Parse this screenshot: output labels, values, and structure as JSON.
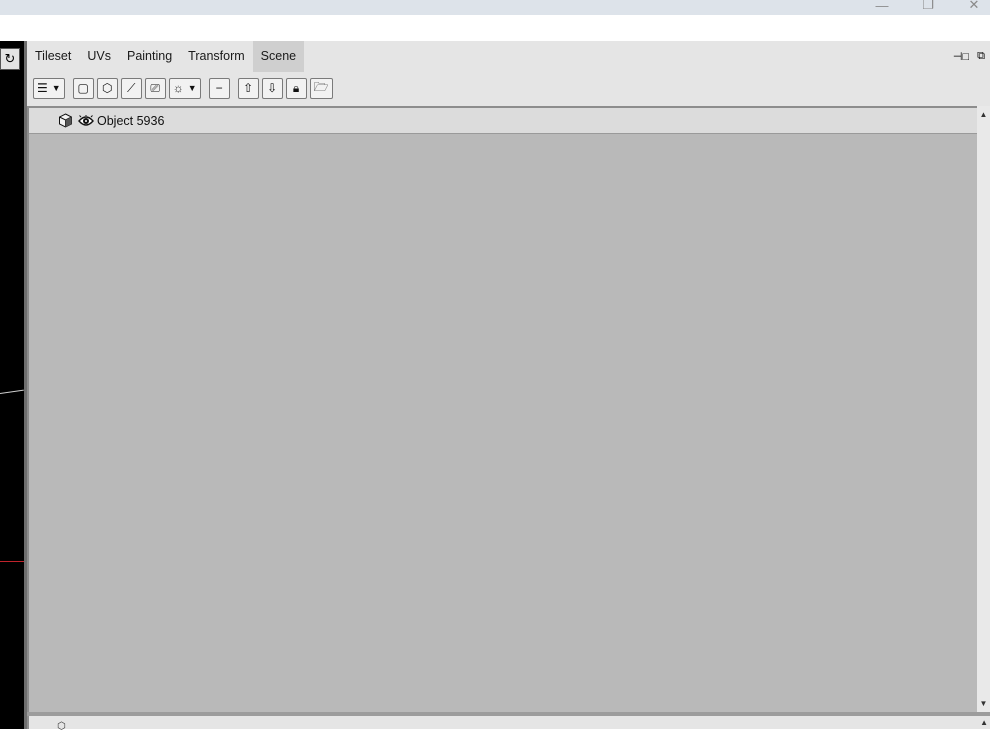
{
  "window": {
    "controls": [
      {
        "name": "minimize-button",
        "glyph": "—"
      },
      {
        "name": "maximize-button",
        "glyph": "❐"
      },
      {
        "name": "close-button",
        "glyph": "✕"
      }
    ]
  },
  "viewport": {
    "refresh_icon": "refresh-icon",
    "refresh_glyph": "↻"
  },
  "tabs": [
    {
      "label": "Tileset",
      "active": false
    },
    {
      "label": "UVs",
      "active": false
    },
    {
      "label": "Painting",
      "active": false
    },
    {
      "label": "Transform",
      "active": false
    },
    {
      "label": "Scene",
      "active": true
    }
  ],
  "dock": {
    "undock_glyph": "⊣□",
    "float_glyph": "⧉"
  },
  "toolbar": [
    {
      "name": "menu-dropdown-button",
      "icon": "hamburger-icon",
      "glyph": "☰",
      "dropdown": true
    },
    {
      "name": "new-shape-button",
      "icon": "shape-icon",
      "glyph": "▢",
      "dropdown": false
    },
    {
      "name": "new-object-button",
      "icon": "cube-icon",
      "glyph": "⬡",
      "dropdown": false
    },
    {
      "name": "new-bone-button",
      "icon": "bone-icon",
      "glyph": "⟋",
      "dropdown": false
    },
    {
      "name": "new-camera-button",
      "icon": "camera-icon",
      "glyph": "⎚",
      "dropdown": false
    },
    {
      "name": "new-light-dropdown-button",
      "icon": "light-icon",
      "glyph": "☼",
      "dropdown": true
    },
    {
      "name": "remove-button",
      "icon": "minus-icon",
      "glyph": "−",
      "dropdown": false
    },
    {
      "name": "move-up-button",
      "icon": "arrow-up-icon",
      "glyph": "⇧",
      "dropdown": false
    },
    {
      "name": "move-down-button",
      "icon": "arrow-down-icon",
      "glyph": "⇩",
      "dropdown": false
    },
    {
      "name": "lock-button",
      "icon": "lock-icon",
      "glyph": "🔒︎",
      "dropdown": false
    },
    {
      "name": "open-folder-button",
      "icon": "folder-icon",
      "glyph": "🗁",
      "dropdown": false
    }
  ],
  "scene": {
    "items": [
      {
        "label": "Object 5936",
        "type_icon": "cube-icon",
        "visibility_icon": "eye-icon"
      }
    ]
  },
  "colors": {
    "panel_bg": "#e5e5e5",
    "list_bg": "#b9b9b9",
    "active_tab": "#cfcfcf",
    "viewport_bg": "#000000",
    "axis_red": "#c0232b"
  }
}
